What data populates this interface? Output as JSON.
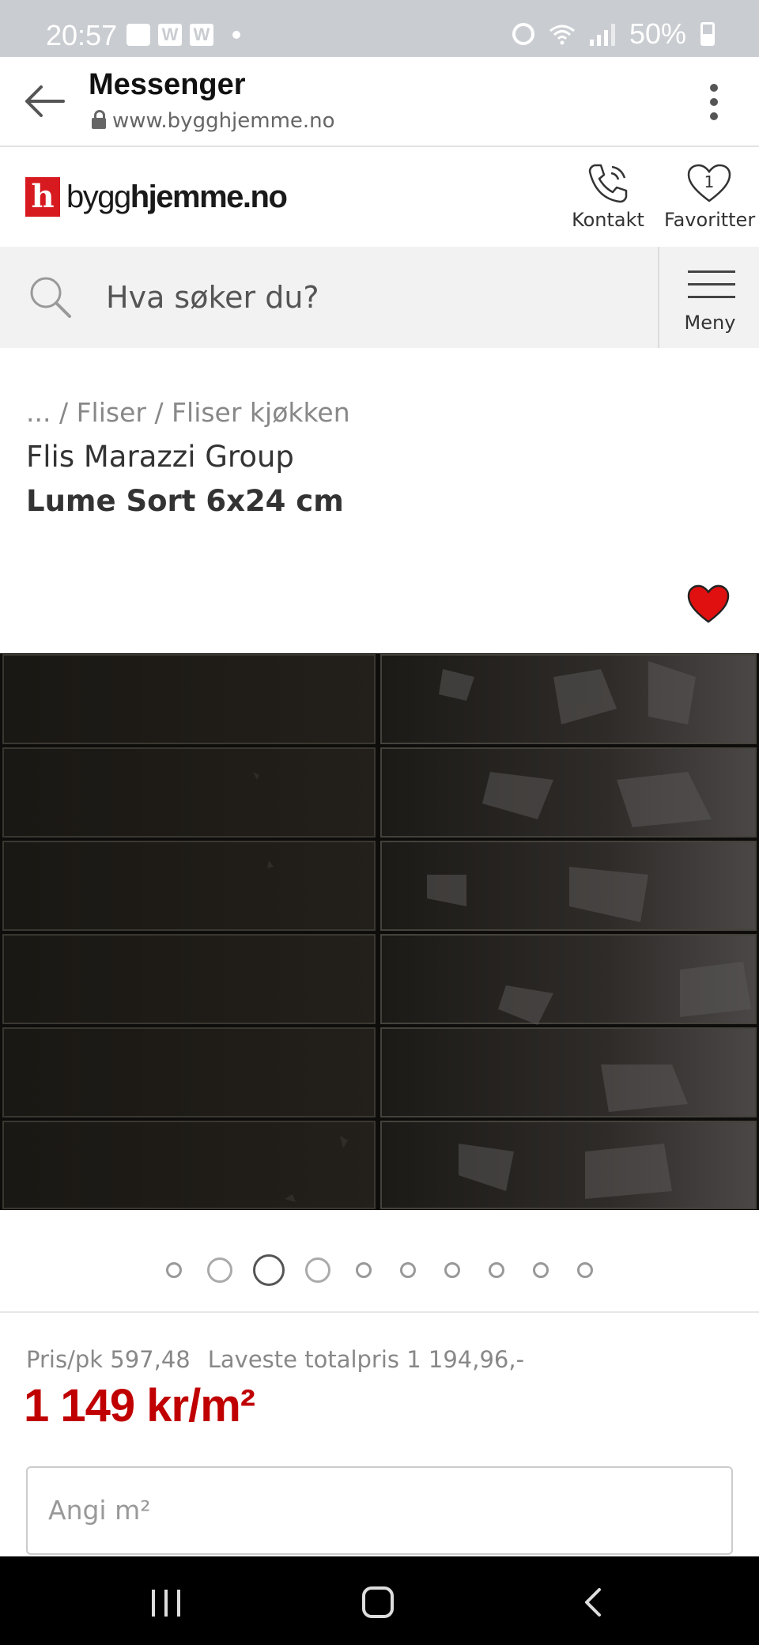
{
  "status_bar": {
    "time": "20:57",
    "w1": "W",
    "w2": "W",
    "battery": "50%"
  },
  "app_bar": {
    "title": "Messenger",
    "url": "www.bygghjemme.no"
  },
  "site_header": {
    "logo_mark": "h",
    "logo_light": "bygg",
    "logo_bold": "hjemme.no",
    "contact_label": "Kontakt",
    "favorites_label": "Favoritter",
    "favorites_count": "1"
  },
  "search": {
    "placeholder": "Hva søker du?",
    "menu_label": "Meny"
  },
  "product": {
    "breadcrumb": "... / Fliser / Fliser kjøkken",
    "brand": "Flis Marazzi Group",
    "name": "Lume Sort 6x24 cm",
    "favorited": true
  },
  "carousel": {
    "total": 10,
    "current_index": 2
  },
  "pricing": {
    "per_pack": "Pris/pk 597,48",
    "lowest_total": "Laveste totalpris 1 194,96,-",
    "main_price": "1 149 kr/m²"
  },
  "quantity_input": {
    "placeholder": "Angi m²"
  },
  "colors": {
    "brand_red": "#d71920",
    "price_red": "#c00000",
    "heart_red": "#e01010",
    "tile_black": "#14120f"
  }
}
